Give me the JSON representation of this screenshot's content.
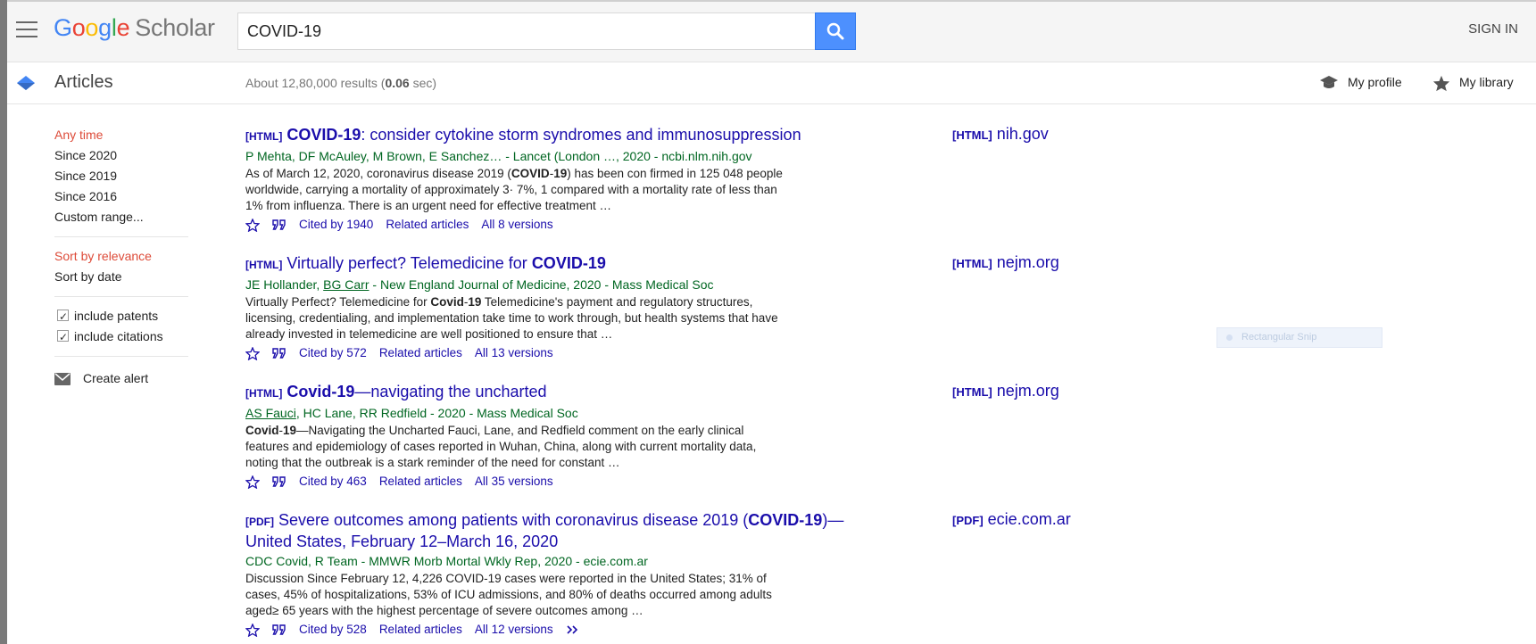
{
  "header": {
    "logo_google": [
      "G",
      "o",
      "o",
      "g",
      "l",
      "e"
    ],
    "logo_scholar": "Scholar",
    "search_value": "COVID-19",
    "sign_in": "SIGN IN"
  },
  "subheader": {
    "section": "Articles",
    "results_prefix": "About 12,80,000 results (",
    "results_time": "0.06",
    "results_suffix": " sec)",
    "my_profile": "My profile",
    "my_library": "My library"
  },
  "sidebar": {
    "time_filters": [
      "Any time",
      "Since 2020",
      "Since 2019",
      "Since 2016",
      "Custom range..."
    ],
    "sort_options": [
      "Sort by relevance",
      "Sort by date"
    ],
    "checkboxes": [
      "include patents",
      "include citations"
    ],
    "create_alert": "Create alert"
  },
  "results": [
    {
      "format": "[HTML]",
      "title_bold": "COVID-19",
      "title_rest": ": consider cytokine storm syndromes and immunosuppression",
      "authors_plain": "P Mehta, DF McAuley, M Brown, E Sanchez… - Lancet (London …, 2020 - ncbi.nlm.nih.gov",
      "snippet_pre": "As of March 12, 2020, coronavirus disease 2019 (",
      "snippet_bold": "COVID",
      "snippet_mid": "-",
      "snippet_bold2": "19",
      "snippet_post": ") has been con firmed in 125 048 people worldwide, carrying a mortality of approximately 3· 7%, 1 compared with a mortality rate of less than 1% from influenza. There is an urgent need for effective treatment …",
      "cited_by": "Cited by 1940",
      "related": "Related articles",
      "versions": "All 8 versions",
      "side_format": "[HTML]",
      "side_domain": "nih.gov"
    },
    {
      "format": "[HTML]",
      "title_plain": "Virtually perfect? Telemedicine for ",
      "title_bold": "COVID-19",
      "authors_pre": "JE Hollander, ",
      "authors_link": "BG Carr",
      "authors_post": " - New England Journal of Medicine, 2020 - Mass Medical Soc",
      "snippet_pre": "Virtually Perfect? Telemedicine for ",
      "snippet_bold": "Covid",
      "snippet_mid": "-",
      "snippet_bold2": "19",
      "snippet_post": " Telemedicine's payment and regulatory structures, licensing, credentialing, and implementation take time to work through, but health systems that have already invested in telemedicine are well positioned to ensure that …",
      "cited_by": "Cited by 572",
      "related": "Related articles",
      "versions": "All 13 versions",
      "side_format": "[HTML]",
      "side_domain": "nejm.org"
    },
    {
      "format": "[HTML]",
      "title_bold": "Covid-19",
      "title_rest": "—navigating the uncharted",
      "authors_link": "AS Fauci",
      "authors_post": ", HC Lane, RR Redfield - 2020 - Mass Medical Soc",
      "snippet_bold": "Covid",
      "snippet_mid": "-",
      "snippet_bold2": "19",
      "snippet_post": "—Navigating the Uncharted Fauci, Lane, and Redfield comment on the early clinical features and epidemiology of cases reported in Wuhan, China, along with current mortality data, noting that the outbreak is a stark reminder of the need for constant …",
      "cited_by": "Cited by 463",
      "related": "Related articles",
      "versions": "All 35 versions",
      "side_format": "[HTML]",
      "side_domain": "nejm.org"
    },
    {
      "format": "[PDF]",
      "title_plain": "Severe outcomes among patients with coronavirus disease 2019 (",
      "title_bold": "COVID-19",
      "title_rest": ")—United States, February 12–March 16, 2020",
      "authors_plain": "CDC Covid, R Team - MMWR Morb Mortal Wkly Rep, 2020 - ecie.com.ar",
      "snippet": "Discussion Since February 12, 4,226 COVID-19 cases were reported in the United States; 31% of cases, 45% of hospitalizations, 53% of ICU admissions, and 80% of deaths occurred among adults aged≥ 65 years with the highest percentage of severe outcomes among …",
      "cited_by": "Cited by 528",
      "related": "Related articles",
      "versions": "All 12 versions",
      "side_format": "[PDF]",
      "side_domain": "ecie.com.ar"
    }
  ],
  "overlay": {
    "snip_label": "Rectangular Snip"
  },
  "icons": {
    "menu": "hamburger-menu-icon",
    "search": "search-icon",
    "scholar": "scholar-cap-icon",
    "profile": "graduation-cap-icon",
    "library": "star-icon",
    "save": "star-outline-icon",
    "cite": "quote-icon",
    "alert": "envelope-icon",
    "more": "double-chevron-icon"
  },
  "colors": {
    "link": "#1a0dab",
    "green": "#006621",
    "active": "#dd4b39",
    "search_button": "#4d90fe"
  }
}
